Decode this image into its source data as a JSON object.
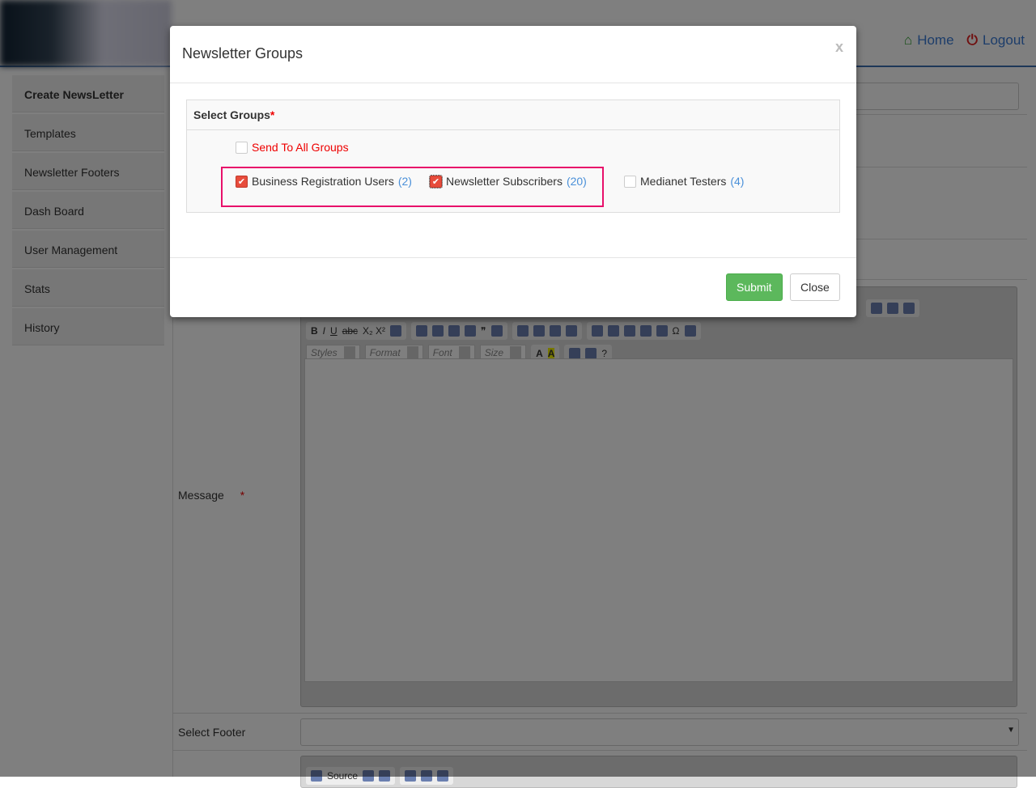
{
  "header": {
    "home": "Home",
    "logout": "Logout",
    "colors": {
      "home_icon": "#2e9e2e",
      "logout_icon": "#e02020"
    }
  },
  "sidebar": {
    "items": [
      {
        "label": "Create NewsLetter",
        "active": true
      },
      {
        "label": "Templates"
      },
      {
        "label": "Newsletter Footers"
      },
      {
        "label": "Dash Board"
      },
      {
        "label": "User Management"
      },
      {
        "label": "Stats"
      },
      {
        "label": "History"
      }
    ]
  },
  "form": {
    "message_label": "Message",
    "required_mark": "*",
    "footer_label": "Select Footer",
    "editor": {
      "styles": "Styles",
      "format": "Format",
      "font": "Font",
      "size": "Size",
      "source": "Source"
    }
  },
  "modal": {
    "title": "Newsletter Groups",
    "close_x": "x",
    "panel_title": "Select Groups",
    "required": "*",
    "send_all": {
      "label": "Send To All Groups",
      "checked": false
    },
    "groups": [
      {
        "label": "Business Registration Users",
        "count": "(2)",
        "checked": true
      },
      {
        "label": "Newsletter Subscribers",
        "count": "(20)",
        "checked": true
      },
      {
        "label": "Medianet Testers",
        "count": "(4)",
        "checked": false
      }
    ],
    "submit": "Submit",
    "close": "Close",
    "colors": {
      "submit": "#5cb85c",
      "highlight": "#e8106a",
      "checkbox": "#e74c3c"
    }
  }
}
